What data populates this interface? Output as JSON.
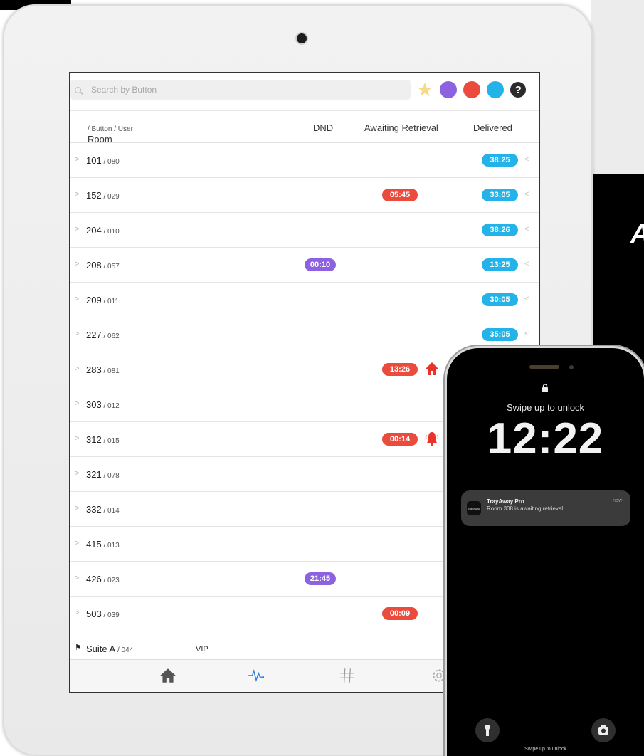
{
  "partial_heading": "A",
  "search": {
    "placeholder": "Search by Button"
  },
  "filters": {
    "colors": {
      "star": "#f8d98a",
      "purple": "#8c62e0",
      "red": "#ea4b3c",
      "blue": "#23b3e8"
    },
    "help_label": "?"
  },
  "columns": {
    "room": "Room",
    "room_sub": " / Button / User",
    "dnd": "DND",
    "awaiting": "Awaiting Retrieval",
    "delivered": "Delivered"
  },
  "rows": [
    {
      "room": "101",
      "button": " / 080",
      "dnd": "",
      "awaiting": "",
      "delivered": "38:25"
    },
    {
      "room": "152",
      "button": " / 029",
      "dnd": "",
      "awaiting": "05:45",
      "delivered": "33:05"
    },
    {
      "room": "204",
      "button": " / 010",
      "dnd": "",
      "awaiting": "",
      "delivered": "38:26"
    },
    {
      "room": "208",
      "button": " / 057",
      "dnd": "00:10",
      "awaiting": "",
      "delivered": "13:25"
    },
    {
      "room": "209",
      "button": " / 011",
      "dnd": "",
      "awaiting": "",
      "delivered": "30:05"
    },
    {
      "room": "227",
      "button": " / 062",
      "dnd": "",
      "awaiting": "",
      "delivered": "35:05"
    },
    {
      "room": "283",
      "button": " / 081",
      "dnd": "",
      "awaiting": "13:26",
      "delivered": "",
      "icon": "house-alert-icon"
    },
    {
      "room": "303",
      "button": " / 012",
      "dnd": "",
      "awaiting": "",
      "delivered": ""
    },
    {
      "room": "312",
      "button": " / 015",
      "dnd": "",
      "awaiting": "00:14",
      "delivered": "",
      "icon": "bell-alert-icon"
    },
    {
      "room": "321",
      "button": " / 078",
      "dnd": "",
      "awaiting": "",
      "delivered": ""
    },
    {
      "room": "332",
      "button": " / 014",
      "dnd": "",
      "awaiting": "",
      "delivered": ""
    },
    {
      "room": "415",
      "button": " / 013",
      "dnd": "",
      "awaiting": "",
      "delivered": ""
    },
    {
      "room": "426",
      "button": " / 023",
      "dnd": "21:45",
      "awaiting": "",
      "delivered": ""
    },
    {
      "room": "503",
      "button": " / 039",
      "dnd": "",
      "awaiting": "00:09",
      "delivered": ""
    }
  ],
  "suite_row": {
    "room": "Suite A",
    "button": " / 044",
    "tag": "VIP"
  },
  "tabbar": [
    "home-icon",
    "activity-icon",
    "hashtag-icon",
    "settings-icon"
  ],
  "phone": {
    "swipe_top": "Swipe up to unlock",
    "time": "12:22",
    "notification": {
      "app_icon_text": "TrayAway",
      "app": "TrayAway Pro",
      "message": "Room 308 is awaiting retrieval",
      "when": "now"
    },
    "swipe_bottom": "Swipe up to unlock"
  }
}
